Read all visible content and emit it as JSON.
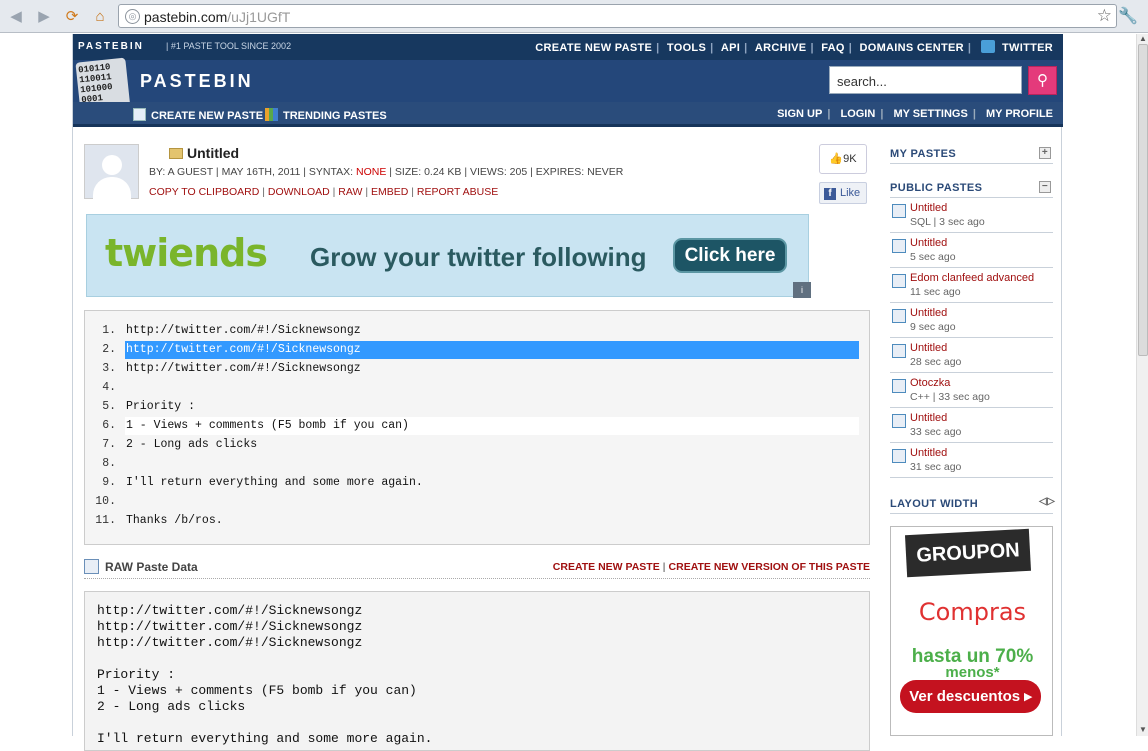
{
  "browser": {
    "url_host": "pastebin.com",
    "url_path": "/uJj1UGfT"
  },
  "header": {
    "brand": "PASTEBIN",
    "tagline": "#1 PASTE TOOL SINCE 2002",
    "nav": [
      "CREATE NEW PASTE",
      "TOOLS",
      "API",
      "ARCHIVE",
      "FAQ",
      "DOMAINS CENTER",
      "TWITTER"
    ],
    "logo_bits": [
      "010110",
      "110011",
      "101000",
      "0001"
    ],
    "logo_name": "PASTEBIN",
    "search_placeholder": "search...",
    "subnav_left": [
      "CREATE NEW PASTE",
      "TRENDING PASTES"
    ],
    "subnav_right": [
      "SIGN UP",
      "LOGIN",
      "MY SETTINGS",
      "MY PROFILE"
    ]
  },
  "paste": {
    "title": "Untitled",
    "by": "BY: A GUEST | MAY 16TH, 2011 | SYNTAX: ",
    "syntax": "NONE",
    "rest": " | SIZE: 0.24 KB | VIEWS: 205 | EXPIRES: NEVER",
    "actions": [
      "COPY TO CLIPBOARD",
      "DOWNLOAD",
      "RAW",
      "EMBED",
      "REPORT ABUSE"
    ],
    "likes": "9K",
    "fb_like": "Like"
  },
  "ad": {
    "brand": "twiends",
    "headline": "Grow your twitter following",
    "button": "Click here"
  },
  "code_lines": [
    {
      "n": "1.",
      "t": "http://twitter.com/#!/Sicknewsongz"
    },
    {
      "n": "2.",
      "t": "http://twitter.com/#!/Sicknewsongz"
    },
    {
      "n": "3.",
      "t": "http://twitter.com/#!/Sicknewsongz"
    },
    {
      "n": "4.",
      "t": ""
    },
    {
      "n": "5.",
      "t": "Priority :"
    },
    {
      "n": "6.",
      "t": "1 - Views + comments (F5 bomb if you can)"
    },
    {
      "n": "7.",
      "t": "2 - Long ads clicks"
    },
    {
      "n": "8.",
      "t": ""
    },
    {
      "n": "9.",
      "t": "I'll return everything and some more again."
    },
    {
      "n": "10.",
      "t": ""
    },
    {
      "n": "11.",
      "t": "Thanks /b/ros."
    }
  ],
  "raw": {
    "title": "RAW Paste Data",
    "links": [
      "CREATE NEW PASTE",
      "CREATE NEW VERSION OF THIS PASTE"
    ],
    "text": "http://twitter.com/#!/Sicknewsongz\nhttp://twitter.com/#!/Sicknewsongz\nhttp://twitter.com/#!/Sicknewsongz\n\nPriority :\n1 - Views + comments (F5 bomb if you can)\n2 - Long ads clicks\n\nI'll return everything and some more again."
  },
  "sidebar": {
    "my_pastes": "MY PASTES",
    "public_pastes": "PUBLIC PASTES",
    "layout_width": "LAYOUT WIDTH",
    "pastes": [
      {
        "name": "Untitled",
        "sub": "SQL | 3 sec ago"
      },
      {
        "name": "Untitled",
        "sub": "5 sec ago"
      },
      {
        "name": "Edom clanfeed advanced",
        "sub": "11 sec ago"
      },
      {
        "name": "Untitled",
        "sub": "9 sec ago"
      },
      {
        "name": "Untitled",
        "sub": "28 sec ago"
      },
      {
        "name": "Otoczka",
        "sub": "C++ | 33 sec ago"
      },
      {
        "name": "Untitled",
        "sub": "33 sec ago"
      },
      {
        "name": "Untitled",
        "sub": "31 sec ago"
      }
    ],
    "groupon": {
      "logo": "GROUPON",
      "line1": "Compras",
      "line2": "hasta un 70%",
      "line3": "menos*",
      "button": "Ver descuentos ▸"
    }
  }
}
